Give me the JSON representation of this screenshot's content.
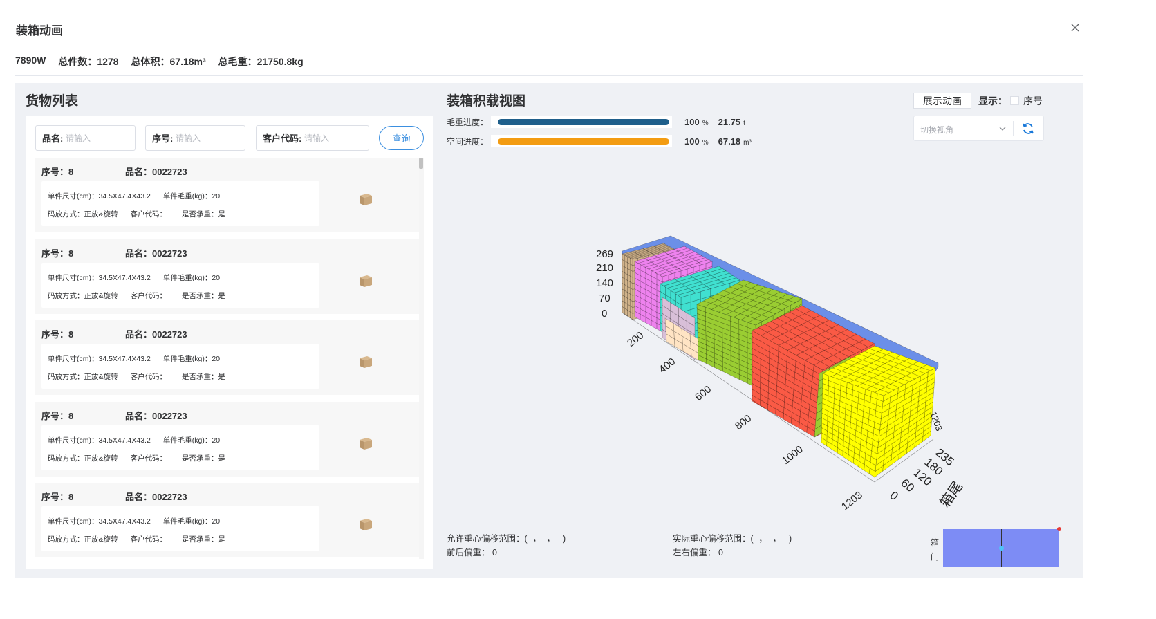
{
  "dialog": {
    "title": "装箱动画"
  },
  "summary": {
    "container": "7890W",
    "total_count_label": "总件数：",
    "total_count": "1278",
    "total_volume_label": "总体积：",
    "total_volume": "67.18m³",
    "total_weight_label": "总毛重：",
    "total_weight": "21750.8kg"
  },
  "left": {
    "title": "货物列表",
    "search": {
      "name_label": "品名:",
      "name_placeholder": "请输入",
      "seq_label": "序号:",
      "seq_placeholder": "请输入",
      "code_label": "客户代码:",
      "code_placeholder": "请输入",
      "query_label": "查询"
    },
    "items": [
      {
        "seq": "序号：8",
        "name": "品名：0022723",
        "size": "单件尺寸(cm)：34.5X47.4X43.2",
        "weight": "单件毛重(kg)：20",
        "stack": "码放方式：正放&旋转",
        "code": "客户代码：",
        "bear": "是否承重：是"
      },
      {
        "seq": "序号：8",
        "name": "品名：0022723",
        "size": "单件尺寸(cm)：34.5X47.4X43.2",
        "weight": "单件毛重(kg)：20",
        "stack": "码放方式：正放&旋转",
        "code": "客户代码：",
        "bear": "是否承重：是"
      },
      {
        "seq": "序号：8",
        "name": "品名：0022723",
        "size": "单件尺寸(cm)：34.5X47.4X43.2",
        "weight": "单件毛重(kg)：20",
        "stack": "码放方式：正放&旋转",
        "code": "客户代码：",
        "bear": "是否承重：是"
      },
      {
        "seq": "序号：8",
        "name": "品名：0022723",
        "size": "单件尺寸(cm)：34.5X47.4X43.2",
        "weight": "单件毛重(kg)：20",
        "stack": "码放方式：正放&旋转",
        "code": "客户代码：",
        "bear": "是否承重：是"
      },
      {
        "seq": "序号：8",
        "name": "品名：0022723",
        "size": "单件尺寸(cm)：34.5X47.4X43.2",
        "weight": "单件毛重(kg)：20",
        "stack": "码放方式：正放&旋转",
        "code": "客户代码：",
        "bear": "是否承重：是"
      }
    ]
  },
  "right": {
    "title": "装箱积载视图",
    "weight_progress": {
      "label": "毛重进度：",
      "percent": 100,
      "percent_text": "100",
      "percent_unit": "%",
      "value": "21.75",
      "unit": "t",
      "color": "#1f5f8b"
    },
    "space_progress": {
      "label": "空间进度：",
      "percent": 100,
      "percent_text": "100",
      "percent_unit": "%",
      "value": "67.18",
      "unit": "m³",
      "color": "#f39c12"
    },
    "anim_button": "展示动画",
    "display_label": "显示：",
    "seq_checkbox_label": "序号",
    "view_select_placeholder": "切换视角",
    "axes": {
      "height_ticks": [
        "269",
        "210",
        "140",
        "70",
        "0"
      ],
      "length_ticks": [
        "200",
        "400",
        "600",
        "800",
        "1000",
        "1203"
      ],
      "width_ticks": [
        "0",
        "60",
        "120",
        "180",
        "235"
      ],
      "top_right_tick": "1203",
      "side_label": "箱尾"
    },
    "cargo_colors": [
      "#d2b48c",
      "#ee82ee",
      "#40e0d0",
      "#9acd32",
      "#fa5a45",
      "#ffff00",
      "#ffe4c4",
      "#d8bfd8",
      "#6b8fe8"
    ],
    "allowed_offset": "允许重心偏移范围：( -， -， - )",
    "actual_offset": "实际重心偏移范围：( -， -， - )",
    "front_back": "前后偏重：  0",
    "left_right": "左右偏重：  0",
    "door_label": "箱门"
  }
}
